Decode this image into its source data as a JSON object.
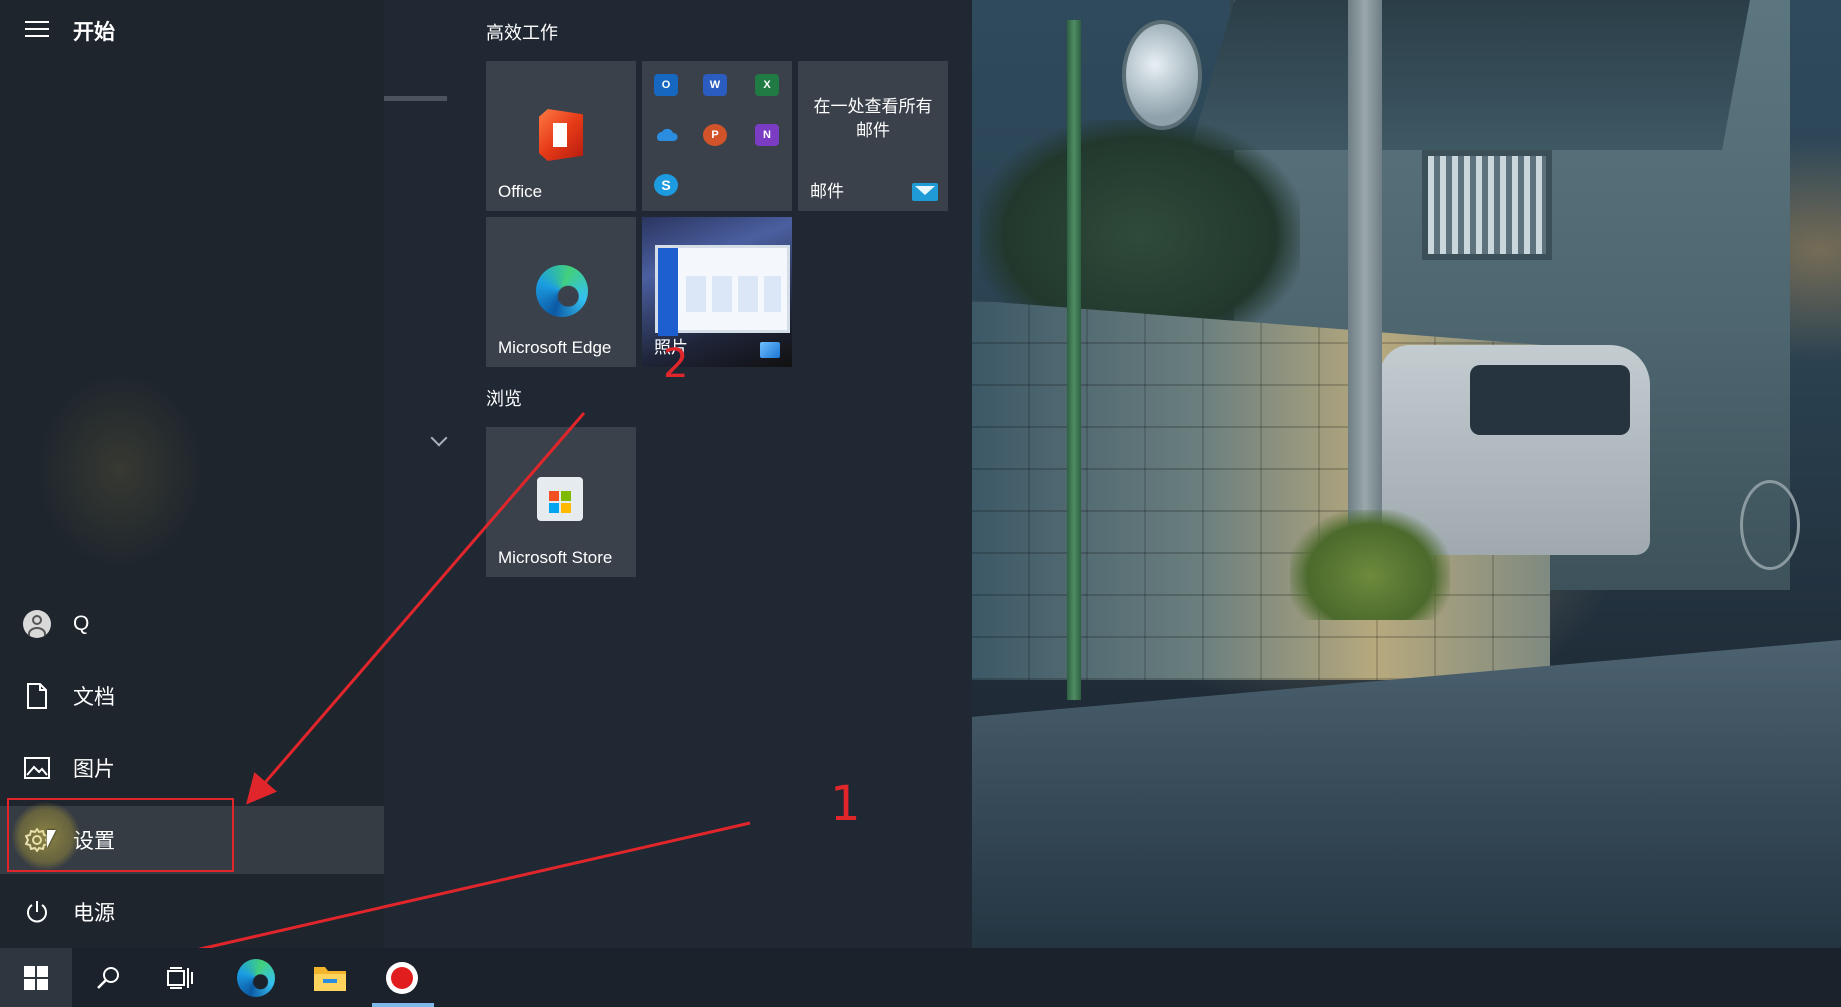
{
  "start_menu": {
    "title": "开始",
    "user_name": "Q",
    "items": {
      "documents": "文档",
      "pictures": "图片",
      "settings": "设置",
      "power": "电源"
    }
  },
  "tiles": {
    "group_productivity": "高效工作",
    "group_browse": "浏览",
    "office": "Office",
    "mail_promo": "在一处查看所有邮件",
    "mail": "邮件",
    "edge": "Microsoft Edge",
    "photos": "照片",
    "store": "Microsoft Store",
    "office_apps": {
      "outlook": "O",
      "word": "W",
      "excel": "X",
      "powerpoint": "P",
      "onenote": "N",
      "skype": "S"
    }
  },
  "annotations": {
    "step1": "1",
    "step2": "2",
    "color": "#e1262b"
  },
  "taskbar": {
    "icons": [
      "windows-start-icon",
      "search-icon",
      "task-view-icon",
      "edge-icon",
      "file-explorer-icon",
      "recorder-icon"
    ]
  },
  "colors": {
    "menu_bg": "#202833",
    "rail_bg": "#1e252d",
    "tile_bg": "#3a414b",
    "taskbar_bg": "#1b222b",
    "active_item": "rgba(255,255,255,0.11)"
  }
}
